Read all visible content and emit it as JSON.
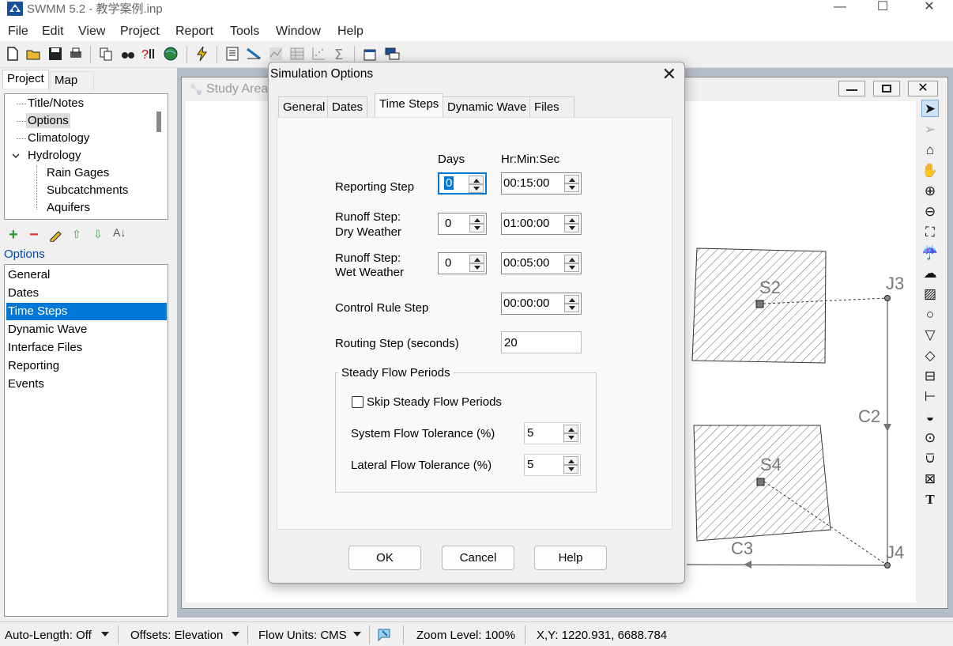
{
  "window": {
    "title": "SWMM 5.2 - 教学案例.inp",
    "minimize": "—",
    "maximize": "☐",
    "close": "✕"
  },
  "menu": [
    "File",
    "Edit",
    "View",
    "Project",
    "Report",
    "Tools",
    "Window",
    "Help"
  ],
  "browser": {
    "tabs": [
      "Project",
      "Map"
    ],
    "tree": {
      "title_notes": "Title/Notes",
      "options": "Options",
      "climatology": "Climatology",
      "hydrology": "Hydrology",
      "rain_gages": "Rain Gages",
      "subcatchments": "Subcatchments",
      "aquifers": "Aquifers"
    },
    "selected_label": "Options",
    "options_list": [
      "General",
      "Dates",
      "Time Steps",
      "Dynamic Wave",
      "Interface Files",
      "Reporting",
      "Events"
    ],
    "selected_option": "Time Steps"
  },
  "map": {
    "window_title": "Study Area",
    "labels": {
      "s2": "S2",
      "s4": "S4",
      "j3": "J3",
      "j4": "J4",
      "c2": "C2",
      "c3": "C3"
    }
  },
  "dialog": {
    "title": "Simulation Options",
    "tabs": [
      "General",
      "Dates",
      "Time Steps",
      "Dynamic Wave",
      "Files"
    ],
    "active_tab": "Time Steps",
    "col_days": "Days",
    "col_hms": "Hr:Min:Sec",
    "reporting_step": {
      "label": "Reporting Step",
      "days": "0",
      "hms": "00:15:00"
    },
    "runoff_dry": {
      "label1": "Runoff Step:",
      "label2": "Dry Weather",
      "days": "0",
      "hms": "01:00:00"
    },
    "runoff_wet": {
      "label1": "Runoff Step:",
      "label2": "Wet Weather",
      "days": "0",
      "hms": "00:05:00"
    },
    "control_rule": {
      "label": "Control Rule Step",
      "hms": "00:00:00"
    },
    "routing_step": {
      "label": "Routing Step (seconds)",
      "value": "20"
    },
    "steady_flow": {
      "group_title": "Steady Flow Periods",
      "skip_label": "Skip Steady Flow Periods",
      "skip_checked": false,
      "system_tol_label": "System Flow Tolerance (%)",
      "system_tol": "5",
      "lateral_tol_label": "Lateral Flow Tolerance (%)",
      "lateral_tol": "5"
    },
    "buttons": {
      "ok": "OK",
      "cancel": "Cancel",
      "help": "Help"
    }
  },
  "status": {
    "auto_length": "Auto-Length: Off",
    "offsets": "Offsets: Elevation",
    "flow_units": "Flow Units: CMS",
    "zoom": "Zoom Level: 100%",
    "xy": "X,Y: 1220.931, 6688.784"
  },
  "colors": {
    "selection": "#0078d7",
    "link_blue": "#0645ad"
  }
}
